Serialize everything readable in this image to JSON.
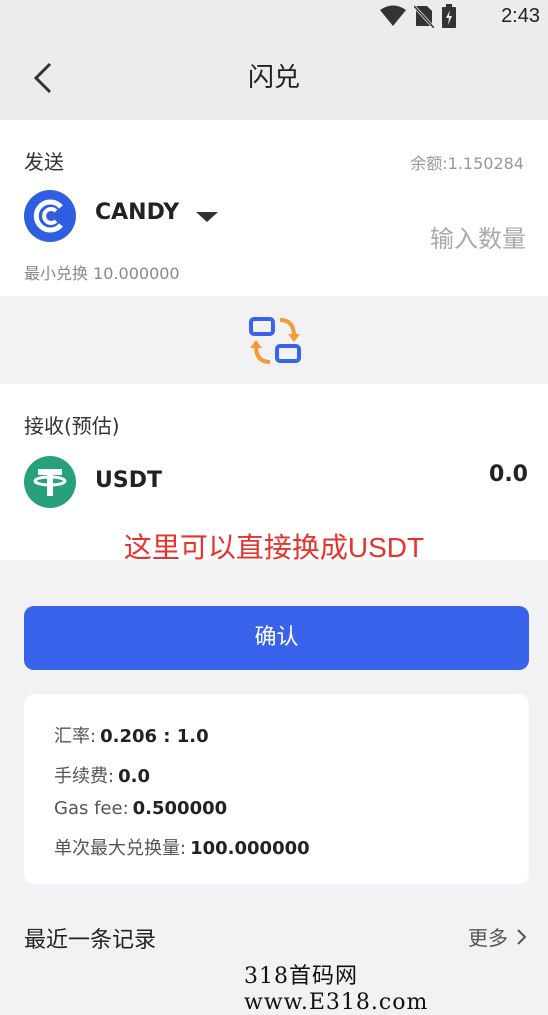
{
  "statusbar": {
    "time": "2:43",
    "icons": [
      "wifi-icon",
      "no-sim-icon",
      "battery-icon"
    ]
  },
  "navbar": {
    "title": "闪兑",
    "back_icon": "chevron-left-icon"
  },
  "send": {
    "label": "发送",
    "balance": "余额:1.150284",
    "coin": "CANDY",
    "amount_placeholder": "输入数量",
    "min_exchange": "最小兑换 10.000000"
  },
  "swap": {
    "icon": "swap-icon"
  },
  "receive": {
    "label": "接收(预估)",
    "coin": "USDT",
    "amount": "0.0",
    "annotation": "这里可以直接换成USDT"
  },
  "confirm": {
    "label": "确认"
  },
  "info": {
    "rate_label": "汇率:",
    "rate_value": "0.206 : 1.0",
    "fee_label": "手续费:",
    "fee_value": "0.0",
    "gas_label": "Gas fee:",
    "gas_value": "0.500000",
    "max_label": "单次最大兑换量:",
    "max_value": "100.000000"
  },
  "recent": {
    "title": "最近一条记录",
    "more": "更多"
  },
  "watermark": "318首码网 www.E318.com",
  "colors": {
    "primary": "#3a63ec",
    "annotation": "#e8322d",
    "usdt": "#26a17b",
    "swap_orange": "#f39a3d"
  }
}
